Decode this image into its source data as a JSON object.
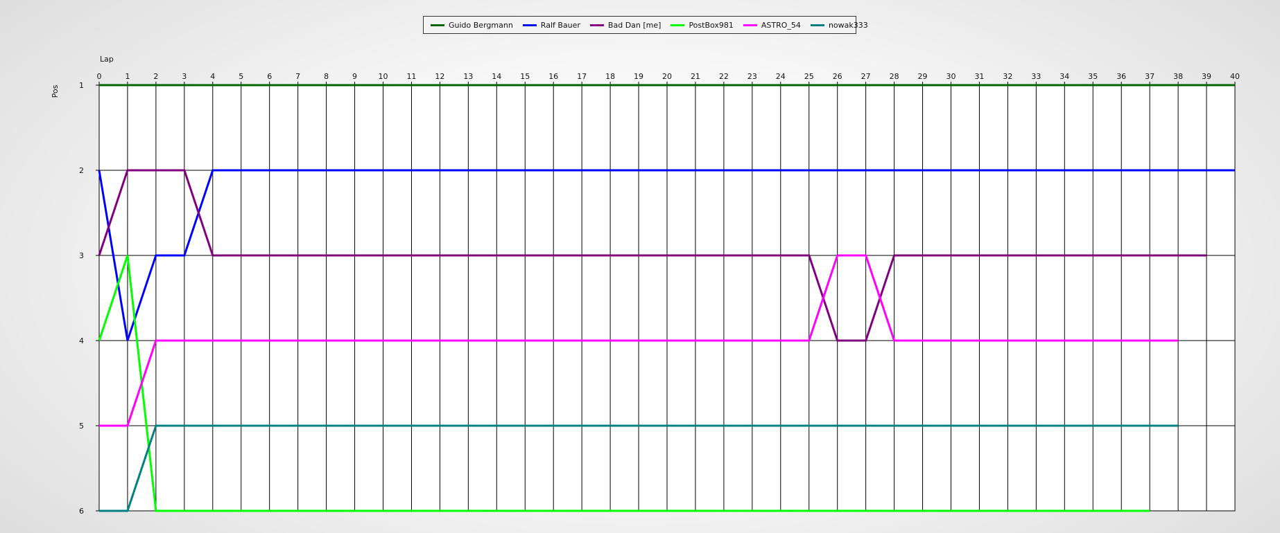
{
  "chart_data": {
    "type": "line",
    "title": "",
    "xlabel": "Lap",
    "ylabel": "Pos",
    "xlim": [
      0,
      40
    ],
    "ylim": [
      1,
      6
    ],
    "y_inverted": true,
    "grid": true,
    "legend_position": "top-center",
    "x_ticks": [
      0,
      1,
      2,
      3,
      4,
      5,
      6,
      7,
      8,
      9,
      10,
      11,
      12,
      13,
      14,
      15,
      16,
      17,
      18,
      19,
      20,
      21,
      22,
      23,
      24,
      25,
      26,
      27,
      28,
      29,
      30,
      31,
      32,
      33,
      34,
      35,
      36,
      37,
      38,
      39,
      40
    ],
    "y_ticks": [
      1,
      2,
      3,
      4,
      5,
      6
    ],
    "series": [
      {
        "name": "Guido Bergmann",
        "color": "#006400",
        "x": [
          0,
          1,
          2,
          3,
          4,
          5,
          6,
          7,
          8,
          9,
          10,
          11,
          12,
          13,
          14,
          15,
          16,
          17,
          18,
          19,
          20,
          21,
          22,
          23,
          24,
          25,
          26,
          27,
          28,
          29,
          30,
          31,
          32,
          33,
          34,
          35,
          36,
          37,
          38,
          39,
          40
        ],
        "values": [
          1,
          1,
          1,
          1,
          1,
          1,
          1,
          1,
          1,
          1,
          1,
          1,
          1,
          1,
          1,
          1,
          1,
          1,
          1,
          1,
          1,
          1,
          1,
          1,
          1,
          1,
          1,
          1,
          1,
          1,
          1,
          1,
          1,
          1,
          1,
          1,
          1,
          1,
          1,
          1,
          1
        ]
      },
      {
        "name": "Ralf Bauer",
        "color": "#0000ff",
        "x": [
          0,
          1,
          2,
          3,
          4,
          5,
          6,
          7,
          8,
          9,
          10,
          11,
          12,
          13,
          14,
          15,
          16,
          17,
          18,
          19,
          20,
          21,
          22,
          23,
          24,
          25,
          26,
          27,
          28,
          29,
          30,
          31,
          32,
          33,
          34,
          35,
          36,
          37,
          38,
          39,
          40
        ],
        "values": [
          2,
          4,
          3,
          3,
          2,
          2,
          2,
          2,
          2,
          2,
          2,
          2,
          2,
          2,
          2,
          2,
          2,
          2,
          2,
          2,
          2,
          2,
          2,
          2,
          2,
          2,
          2,
          2,
          2,
          2,
          2,
          2,
          2,
          2,
          2,
          2,
          2,
          2,
          2,
          2,
          2
        ]
      },
      {
        "name": "Bad Dan [me]",
        "color": "#800080",
        "x": [
          0,
          1,
          2,
          3,
          4,
          5,
          6,
          7,
          8,
          9,
          10,
          11,
          12,
          13,
          14,
          15,
          16,
          17,
          18,
          19,
          20,
          21,
          22,
          23,
          24,
          25,
          26,
          27,
          28,
          29,
          30,
          31,
          32,
          33,
          34,
          35,
          36,
          37,
          38,
          39
        ],
        "values": [
          3,
          2,
          2,
          2,
          3,
          3,
          3,
          3,
          3,
          3,
          3,
          3,
          3,
          3,
          3,
          3,
          3,
          3,
          3,
          3,
          3,
          3,
          3,
          3,
          3,
          3,
          4,
          4,
          3,
          3,
          3,
          3,
          3,
          3,
          3,
          3,
          3,
          3,
          3,
          3
        ]
      },
      {
        "name": "PostBox981",
        "color": "#00ff00",
        "x": [
          0,
          1,
          2,
          3,
          4,
          5,
          6,
          7,
          8,
          9,
          10,
          11,
          12,
          13,
          14,
          15,
          16,
          17,
          18,
          19,
          20,
          21,
          22,
          23,
          24,
          25,
          26,
          27,
          28,
          29,
          30,
          31,
          32,
          33,
          34,
          35,
          36,
          37
        ],
        "values": [
          4,
          3,
          6,
          6,
          6,
          6,
          6,
          6,
          6,
          6,
          6,
          6,
          6,
          6,
          6,
          6,
          6,
          6,
          6,
          6,
          6,
          6,
          6,
          6,
          6,
          6,
          6,
          6,
          6,
          6,
          6,
          6,
          6,
          6,
          6,
          6,
          6,
          6
        ]
      },
      {
        "name": "ASTRO_54",
        "color": "#ff00ff",
        "x": [
          0,
          1,
          2,
          3,
          4,
          5,
          6,
          7,
          8,
          9,
          10,
          11,
          12,
          13,
          14,
          15,
          16,
          17,
          18,
          19,
          20,
          21,
          22,
          23,
          24,
          25,
          26,
          27,
          28,
          29,
          30,
          31,
          32,
          33,
          34,
          35,
          36,
          37,
          38
        ],
        "values": [
          5,
          5,
          4,
          4,
          4,
          4,
          4,
          4,
          4,
          4,
          4,
          4,
          4,
          4,
          4,
          4,
          4,
          4,
          4,
          4,
          4,
          4,
          4,
          4,
          4,
          4,
          3,
          3,
          4,
          4,
          4,
          4,
          4,
          4,
          4,
          4,
          4,
          4,
          4
        ]
      },
      {
        "name": "nowak333",
        "color": "#008080",
        "x": [
          0,
          1,
          2,
          3,
          4,
          5,
          6,
          7,
          8,
          9,
          10,
          11,
          12,
          13,
          14,
          15,
          16,
          17,
          18,
          19,
          20,
          21,
          22,
          23,
          24,
          25,
          26,
          27,
          28,
          29,
          30,
          31,
          32,
          33,
          34,
          35,
          36,
          37,
          38
        ],
        "values": [
          6,
          6,
          5,
          5,
          5,
          5,
          5,
          5,
          5,
          5,
          5,
          5,
          5,
          5,
          5,
          5,
          5,
          5,
          5,
          5,
          5,
          5,
          5,
          5,
          5,
          5,
          5,
          5,
          5,
          5,
          5,
          5,
          5,
          5,
          5,
          5,
          5,
          5,
          5
        ]
      }
    ]
  }
}
